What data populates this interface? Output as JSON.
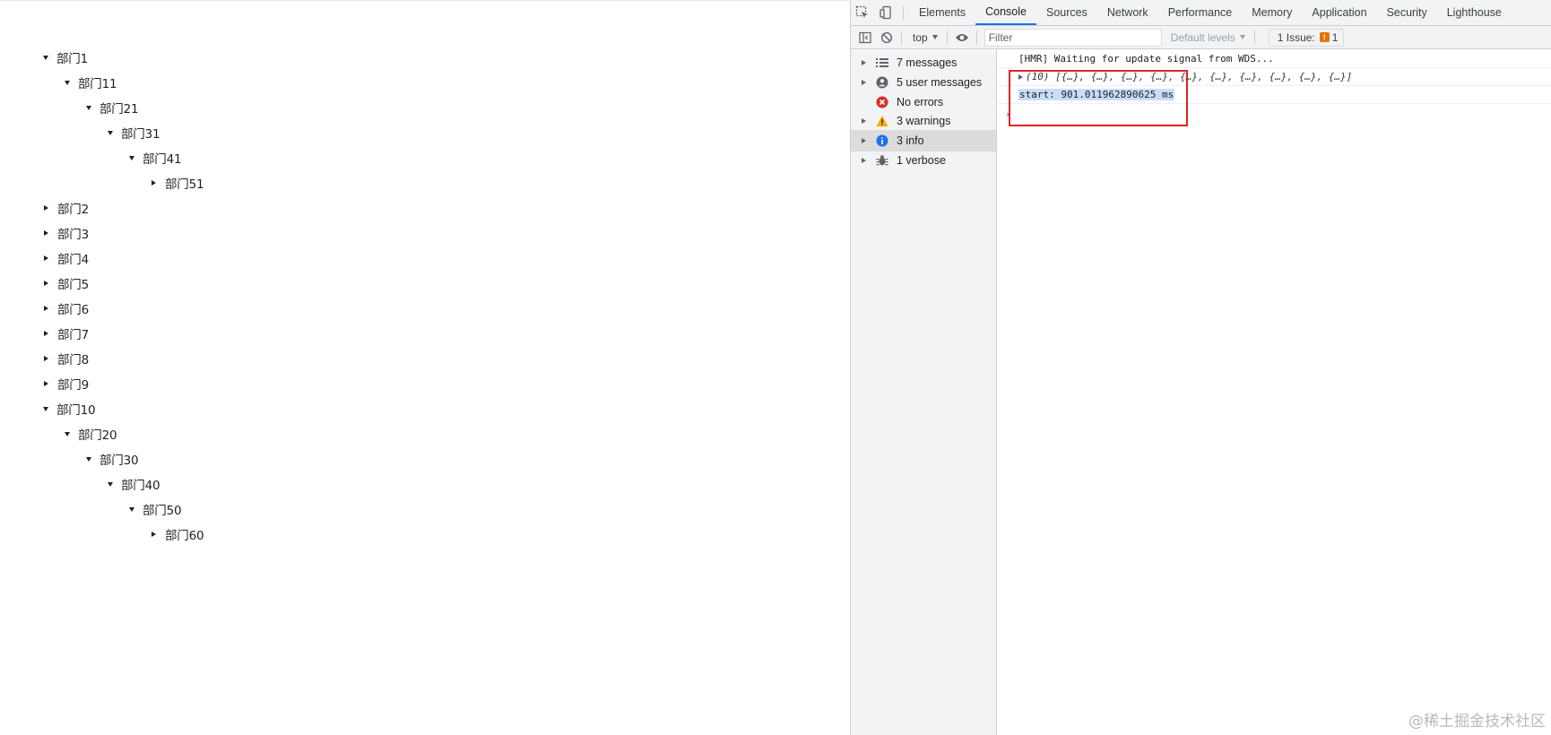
{
  "tree": {
    "items": [
      {
        "label": "部门1",
        "level": 0,
        "expanded": true
      },
      {
        "label": "部门11",
        "level": 1,
        "expanded": true
      },
      {
        "label": "部门21",
        "level": 2,
        "expanded": true
      },
      {
        "label": "部门31",
        "level": 3,
        "expanded": true
      },
      {
        "label": "部门41",
        "level": 4,
        "expanded": true
      },
      {
        "label": "部门51",
        "level": 5,
        "expanded": false
      },
      {
        "label": "部门2",
        "level": 0,
        "expanded": false
      },
      {
        "label": "部门3",
        "level": 0,
        "expanded": false
      },
      {
        "label": "部门4",
        "level": 0,
        "expanded": false
      },
      {
        "label": "部门5",
        "level": 0,
        "expanded": false
      },
      {
        "label": "部门6",
        "level": 0,
        "expanded": false
      },
      {
        "label": "部门7",
        "level": 0,
        "expanded": false
      },
      {
        "label": "部门8",
        "level": 0,
        "expanded": false
      },
      {
        "label": "部门9",
        "level": 0,
        "expanded": false
      },
      {
        "label": "部门10",
        "level": 0,
        "expanded": true
      },
      {
        "label": "部门20",
        "level": 1,
        "expanded": true
      },
      {
        "label": "部门30",
        "level": 2,
        "expanded": true
      },
      {
        "label": "部门40",
        "level": 3,
        "expanded": true
      },
      {
        "label": "部门50",
        "level": 4,
        "expanded": true
      },
      {
        "label": "部门60",
        "level": 5,
        "expanded": false
      }
    ]
  },
  "devtools": {
    "tabs": [
      {
        "label": "Elements",
        "active": false
      },
      {
        "label": "Console",
        "active": true
      },
      {
        "label": "Sources",
        "active": false
      },
      {
        "label": "Network",
        "active": false
      },
      {
        "label": "Performance",
        "active": false
      },
      {
        "label": "Memory",
        "active": false
      },
      {
        "label": "Application",
        "active": false
      },
      {
        "label": "Security",
        "active": false
      },
      {
        "label": "Lighthouse",
        "active": false
      }
    ],
    "toolbar": {
      "context": "top",
      "filter_placeholder": "Filter",
      "levels_label": "Default levels",
      "issues_label": "1 Issue:",
      "issues_count": "1"
    },
    "sidebar": {
      "items": [
        {
          "label": "7 messages",
          "icon": "list-icon",
          "expandable": true,
          "selected": false
        },
        {
          "label": "5 user messages",
          "icon": "user-icon",
          "expandable": true,
          "selected": false
        },
        {
          "label": "No errors",
          "icon": "error-icon",
          "expandable": false,
          "selected": false
        },
        {
          "label": "3 warnings",
          "icon": "warning-icon",
          "expandable": true,
          "selected": false
        },
        {
          "label": "3 info",
          "icon": "info-icon",
          "expandable": true,
          "selected": true
        },
        {
          "label": "1 verbose",
          "icon": "bug-icon",
          "expandable": true,
          "selected": false
        }
      ]
    },
    "console": {
      "hmr_line": "[HMR] Waiting for update signal from WDS...",
      "array_line": "(10) [{…}, {…}, {…}, {…}, {…}, {…}, {…}, {…}, {…}, {…}]",
      "timer_line": "start: 901.011962890625 ms",
      "prompt": "›"
    },
    "colors": {
      "accent": "#1a73e8",
      "highlight_box": "#e02424",
      "selection": "#c8ddf8"
    }
  },
  "watermark": "@稀土掘金技术社区"
}
